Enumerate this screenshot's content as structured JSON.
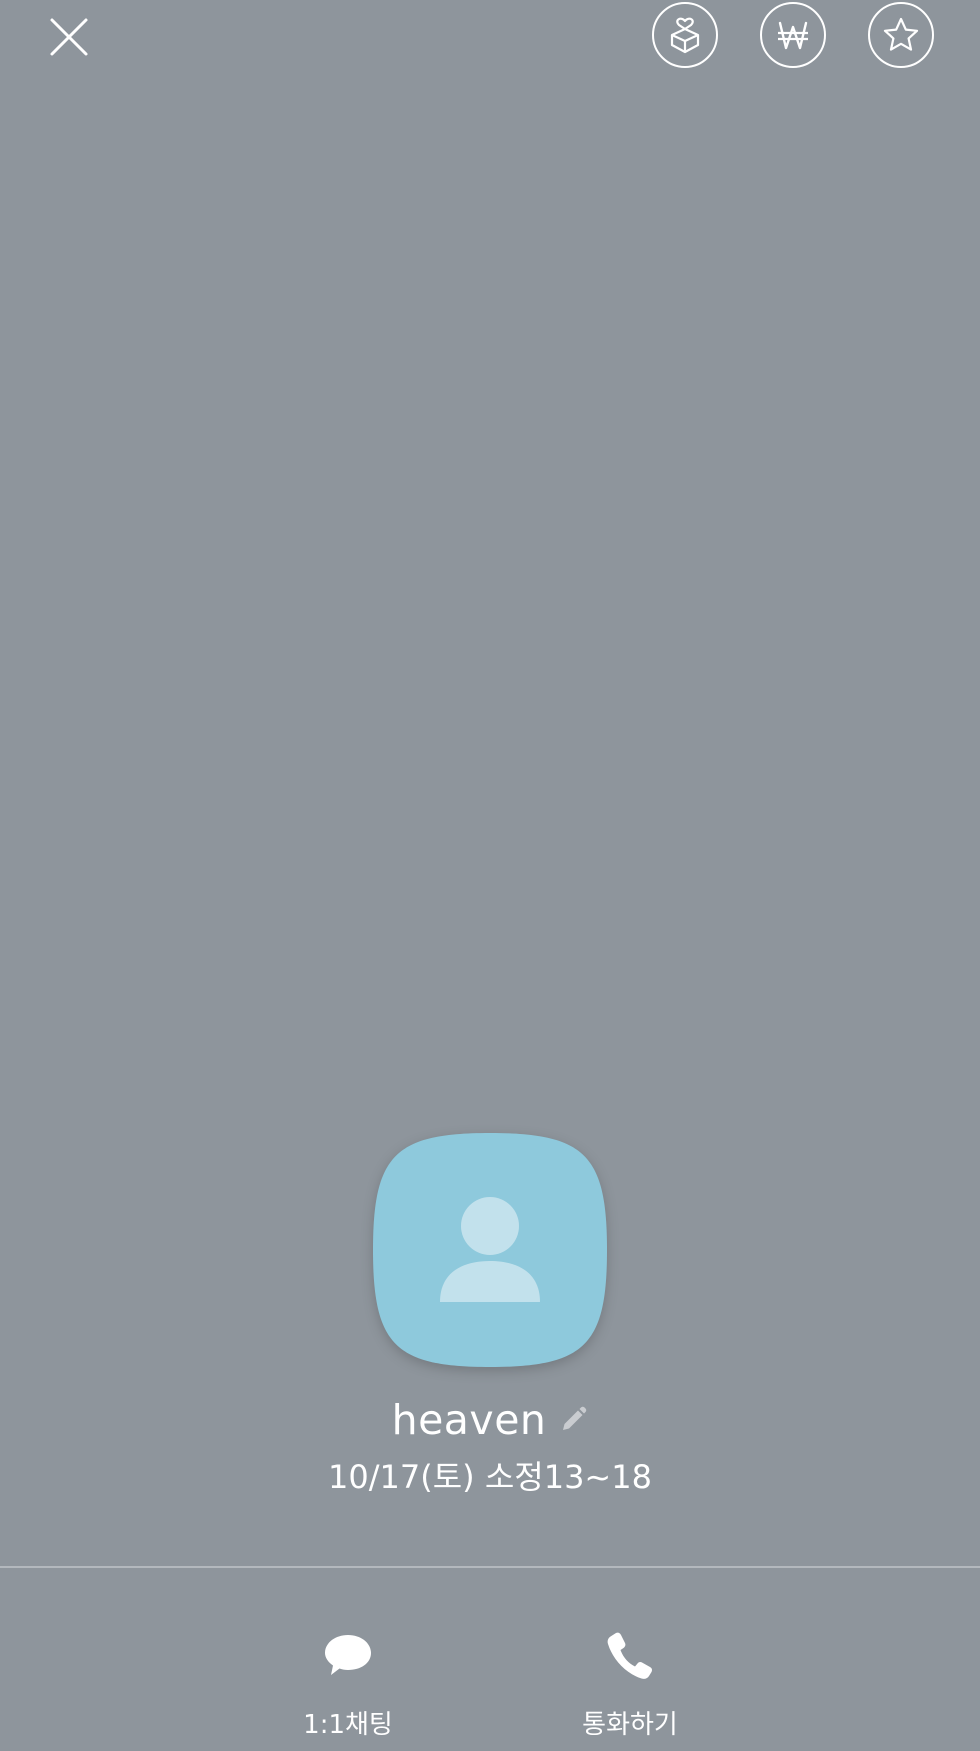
{
  "topbar": {
    "close_icon": "close-icon",
    "actions": [
      {
        "name": "gift-icon",
        "label": ""
      },
      {
        "name": "won-currency-icon",
        "label": ""
      },
      {
        "name": "star-icon",
        "label": ""
      }
    ]
  },
  "profile": {
    "name": "heaven",
    "status": "10/17(토) 소정13~18",
    "avatar_color": "#8ec9dc"
  },
  "actions": {
    "chat_label": "1:1채팅",
    "call_label": "통화하기"
  },
  "colors": {
    "background": "#8e959c",
    "text": "#ffffff",
    "divider": "#b3b8bd"
  }
}
